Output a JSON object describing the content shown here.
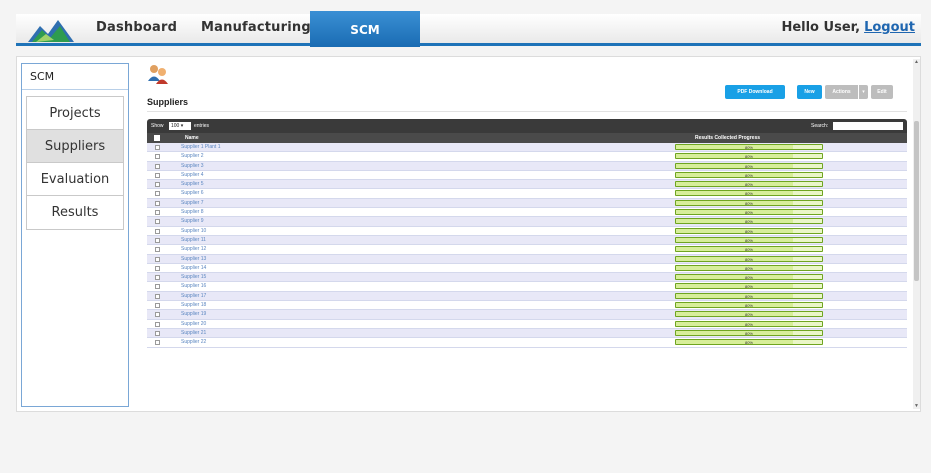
{
  "nav": {
    "tabs": [
      "Dashboard",
      "Manufacturing"
    ],
    "active_tab": "SCM",
    "greeting": "Hello User,",
    "logout": "Logout"
  },
  "sidebar": {
    "header": "SCM",
    "items": [
      "Projects",
      "Suppliers",
      "Evaluation",
      "Results"
    ],
    "active": "Suppliers"
  },
  "page": {
    "title": "Suppliers",
    "buttons": {
      "pdf": "PDF Download",
      "new": "New",
      "actions": "Actions",
      "caret": "▾",
      "edit": "Edit"
    }
  },
  "table": {
    "show_label": "Show",
    "entries_value": "100 ▾",
    "entries_label": "entries",
    "search_label": "Search:",
    "search_value": "",
    "columns": [
      "Name",
      "Results Collected Progress"
    ],
    "rows": [
      {
        "name": "Supplier 1 Plant 1",
        "progress": "80%",
        "progress_value": 80
      },
      {
        "name": "Supplier 2",
        "progress": "80%",
        "progress_value": 80
      },
      {
        "name": "Supplier 3",
        "progress": "80%",
        "progress_value": 80
      },
      {
        "name": "Supplier 4",
        "progress": "80%",
        "progress_value": 80
      },
      {
        "name": "Supplier 5",
        "progress": "80%",
        "progress_value": 80
      },
      {
        "name": "Supplier 6",
        "progress": "80%",
        "progress_value": 80
      },
      {
        "name": "Supplier 7",
        "progress": "80%",
        "progress_value": 80
      },
      {
        "name": "Supplier 8",
        "progress": "80%",
        "progress_value": 80
      },
      {
        "name": "Supplier 9",
        "progress": "80%",
        "progress_value": 80
      },
      {
        "name": "Supplier 10",
        "progress": "80%",
        "progress_value": 80
      },
      {
        "name": "Supplier 11",
        "progress": "80%",
        "progress_value": 80
      },
      {
        "name": "Supplier 12",
        "progress": "80%",
        "progress_value": 80
      },
      {
        "name": "Supplier 13",
        "progress": "80%",
        "progress_value": 80
      },
      {
        "name": "Supplier 14",
        "progress": "80%",
        "progress_value": 80
      },
      {
        "name": "Supplier 15",
        "progress": "80%",
        "progress_value": 80
      },
      {
        "name": "Supplier 16",
        "progress": "80%",
        "progress_value": 80
      },
      {
        "name": "Supplier 17",
        "progress": "80%",
        "progress_value": 80
      },
      {
        "name": "Supplier 18",
        "progress": "80%",
        "progress_value": 80
      },
      {
        "name": "Supplier 19",
        "progress": "80%",
        "progress_value": 80
      },
      {
        "name": "Supplier 20",
        "progress": "80%",
        "progress_value": 80
      },
      {
        "name": "Supplier 21",
        "progress": "80%",
        "progress_value": 80
      },
      {
        "name": "Supplier 22",
        "progress": "80%",
        "progress_value": 80
      }
    ]
  },
  "colors": {
    "accent_blue": "#1e73b8",
    "button_blue": "#19a0e6",
    "progress_green": "#6fa520",
    "row_stripe": "#e8e8f7"
  },
  "icons": {
    "logo": "mountain-logo-icon",
    "suppliers": "users-icon",
    "scroll_up": "▲",
    "scroll_down": "▼"
  }
}
